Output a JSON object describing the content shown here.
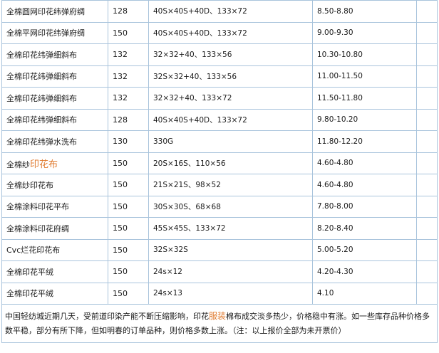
{
  "rows": [
    {
      "name": "全棉圆网印花纬弹府绸",
      "width": "128",
      "spec": "40S×40S+40D、133×72",
      "price": "8.50-8.80"
    },
    {
      "name": "全棉平网印花纬弹府绸",
      "width": "150",
      "spec": "40S×40S+40D、133×72",
      "price": "9.00-9.30"
    },
    {
      "name": "全棉印花纬弹细斜布",
      "width": "132",
      "spec": "32×32+40、133×56",
      "price": "10.30-10.80"
    },
    {
      "name": "全棉印花纬弹细斜布",
      "width": "132",
      "spec": "32S×32+40、133×56",
      "price": "11.00-11.50"
    },
    {
      "name": "全棉印花纬弹细斜布",
      "width": "132",
      "spec": "32×32+40、133×72",
      "price": "11.50-11.80"
    },
    {
      "name": "全棉印花纬弹细斜布",
      "width": "128",
      "spec": "40S×40S+40D、133×72",
      "price": "9.80-10.20"
    },
    {
      "name": "全棉印花纬弹水洗布",
      "width": "130",
      "spec": "330G",
      "price": "11.80-12.20"
    },
    {
      "name_prefix": "全棉纱",
      "name_link": "印花布",
      "width": "150",
      "spec": "20S×16S、110×56",
      "price": "4.60-4.80"
    },
    {
      "name": "全棉纱印花布",
      "width": "150",
      "spec": "21S×21S、98×52",
      "price": "4.60-4.80"
    },
    {
      "name": "全棉涂料印花平布",
      "width": "150",
      "spec": "30S×30S、68×68",
      "price": "7.80-8.00"
    },
    {
      "name": "全棉涂料印花府绸",
      "width": "150",
      "spec": "45S×45S、133×72",
      "price": "8.20-8.40"
    },
    {
      "name": "Cvc烂花印花布",
      "width": "150",
      "spec": "32S×32S",
      "price": "5.00-5.20"
    },
    {
      "name": "全棉印花平绒",
      "width": "150",
      "spec": "24s×12",
      "price": "4.20-4.30"
    },
    {
      "name": "全棉印花平绒",
      "width": "150",
      "spec": "24s×13",
      "price": "4.10"
    }
  ],
  "note": {
    "before": "中国轻纺城近期几天，受前道印染产能不断压缩影响，印花",
    "link": "服装",
    "after": "棉布成交淡多热少，价格稳中有涨。如一些库存品种价格多数平稳，部分有所下降，但如明春的订单品种，则价格多数上涨。（注：以上报价全部为未开票价）"
  },
  "colors": {
    "border": "#a9c4dc",
    "link": "#e07a2e",
    "text": "#1a1a1a"
  }
}
